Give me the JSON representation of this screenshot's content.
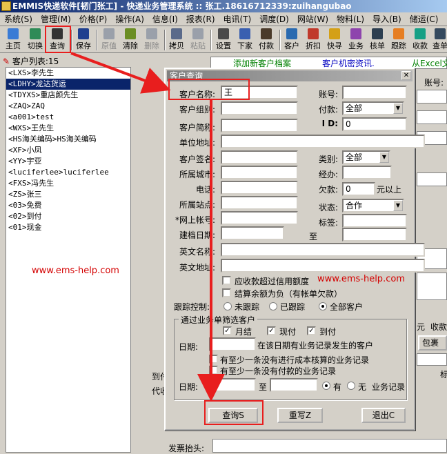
{
  "titlebar": {
    "text": "EMMIS快递软件[韧门张工] - 快递业务管理系统 :: 张工.18616712339:zuihangubao"
  },
  "menubar": [
    "系统(S)",
    "管理(M)",
    "价格(P)",
    "操作(A)",
    "信息(I)",
    "报表(R)",
    "电讯(T)",
    "调度(D)",
    "网站(W)",
    "物料(L)",
    "导入(B)",
    "储运(C)"
  ],
  "toolbar": {
    "items": [
      {
        "id": "home",
        "label": "主页",
        "color": "#3a7bd5"
      },
      {
        "id": "switch",
        "label": "切换",
        "color": "#2e8b57"
      },
      {
        "id": "query",
        "label": "查询",
        "color": "#333333"
      },
      {
        "id": "save",
        "label": "保存",
        "color": "#1f3f8f"
      },
      {
        "id": "revert",
        "label": "原值",
        "color": "#9aa0aa"
      },
      {
        "id": "clear",
        "label": "清除",
        "color": "#6b8e23"
      },
      {
        "id": "delete",
        "label": "删除",
        "color": "#9aa0aa"
      },
      {
        "id": "copy",
        "label": "拷贝",
        "color": "#5a6a8a"
      },
      {
        "id": "paste",
        "label": "粘贴",
        "color": "#9aa0aa"
      },
      {
        "id": "settings",
        "label": "设置",
        "color": "#4a4a4a"
      },
      {
        "id": "download",
        "label": "下家",
        "color": "#3a5fb0"
      },
      {
        "id": "payment",
        "label": "付款",
        "color": "#4a3a2a"
      },
      {
        "id": "customer",
        "label": "客户",
        "color": "#2a6ab0"
      },
      {
        "id": "discount",
        "label": "折扣",
        "color": "#c0392b"
      },
      {
        "id": "quicksearch",
        "label": "快寻",
        "color": "#d4a017"
      },
      {
        "id": "business",
        "label": "业务",
        "color": "#8e44ad"
      },
      {
        "id": "verify",
        "label": "核单",
        "color": "#2c3e50"
      },
      {
        "id": "track",
        "label": "跟踪",
        "color": "#e67e22"
      },
      {
        "id": "collect",
        "label": "收款",
        "color": "#16a085"
      },
      {
        "id": "lookup",
        "label": "查单",
        "color": "#34495e"
      }
    ]
  },
  "left": {
    "list_label": "客户列表:15",
    "items": [
      "<LXS>李先生",
      "<LDHY>龙达货运",
      "<TDYXS>重店颜先生",
      "<ZAQ>ZAQ",
      "<a001>test",
      "<WXS>王先生",
      "<HS海关编码>HS海关编码",
      "<XF>小凤",
      "<YY>宇亚",
      "<luciferlee>luciferlee",
      "<FXS>冯先生",
      "<ZS>张三",
      "<03>免费",
      "<02>到付",
      "<01>现金"
    ],
    "selected_index": 1,
    "watermark": "www.ems-help.com"
  },
  "main": {
    "add_link": "添加新客户档案",
    "pwd_link": "客户机密资讯.",
    "excel_link": "从Excel文",
    "account_label": "账号:",
    "bg_labels": {
      "to": "到付",
      "code": "代收",
      "fee": "元",
      "collect": "收款",
      "wrap": "包裹",
      "mark": "标"
    },
    "invoice_label": "发票抬头:"
  },
  "dialog": {
    "title": "客户查询",
    "labels": {
      "name": "客户名称:",
      "group": "客户组别:",
      "short": "客户简称:",
      "addr": "单位地址:",
      "sign": "客户签名:",
      "city": "所属城市:",
      "phone": "电话:",
      "site": "所属站点:",
      "net": "*网上帐号:",
      "date": "建档日期:",
      "ename": "英文名称:",
      "eaddr": "英文地址:",
      "account": "账号:",
      "pay": "付款:",
      "id": "I D:",
      "type": "类别:",
      "handler": "经办:",
      "owed": "欠款:",
      "owed_unit": "元以上",
      "status": "状态:",
      "tag": "标签:",
      "to": "至"
    },
    "values": {
      "name": "王",
      "pay": "全部",
      "id": "0",
      "type": "全部",
      "owed": "0",
      "status": "合作"
    },
    "checks": {
      "over_credit": "应收款超过信用额度",
      "negative": "结算余额为负（有帐单欠款）"
    },
    "watermark": "www.ems-help.com",
    "track": {
      "label": "跟踪控制:",
      "opt1": "未跟踪",
      "opt2": "已跟踪",
      "opt3": "全部客户"
    },
    "group": {
      "title": "通过业务单筛选客户",
      "monthly": "月结",
      "cash": "现付",
      "cod": "到付",
      "date_label": "日期:",
      "desc1": "在该日期有业务记录发生的客户",
      "chk_cost": "有至少一条没有进行成本核算的业务记录",
      "chk_pay": "有至少一条没有付款的业务记录",
      "to": "至",
      "has": "有",
      "none": "无",
      "record": "业务记录"
    },
    "buttons": {
      "query": "查询S",
      "reset": "重写Z",
      "exit": "退出C"
    }
  }
}
